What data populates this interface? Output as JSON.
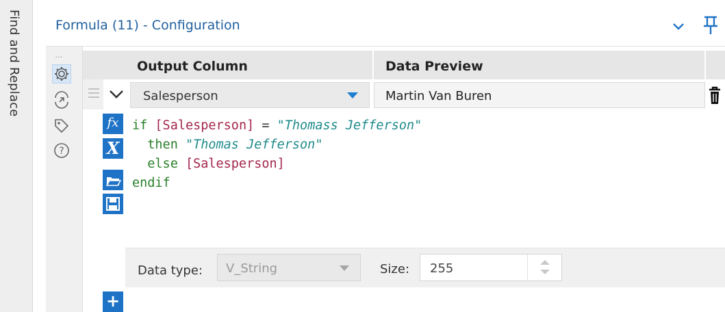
{
  "side_tab": {
    "label": "Find and Replace"
  },
  "header": {
    "title": "Formula (11) - Configuration"
  },
  "icon_column": {
    "dots": "…",
    "icons": [
      "gear-icon",
      "output-arrow-icon",
      "tag-icon",
      "help-icon"
    ]
  },
  "grid": {
    "columns": {
      "output": "Output Column",
      "preview": "Data Preview"
    },
    "row": {
      "output_column": "Salesperson",
      "data_preview": "Martin Van Buren"
    }
  },
  "formula": {
    "lines": [
      "if [Salesperson] = \"Thomass Jefferson\"",
      "  then \"Thomas Jefferson\"",
      "  else [Salesperson]",
      "endif"
    ],
    "tools": {
      "fx": "fx",
      "var": "X"
    }
  },
  "settings": {
    "data_type_label": "Data type:",
    "data_type_value": "V_String",
    "size_label": "Size:",
    "size_value": "255"
  },
  "add_button": {
    "label": "+"
  },
  "colors": {
    "accent": "#1f73c6",
    "keyword": "#2a7f2a",
    "field": "#a3264b",
    "string": "#1f8a8a",
    "title": "#1f5f9f"
  }
}
